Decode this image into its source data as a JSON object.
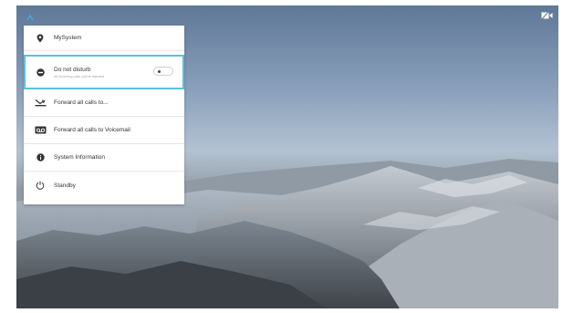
{
  "menu": {
    "system_name": "MySystem",
    "do_not_disturb": {
      "label": "Do not disturb",
      "subtitle": "All incoming calls will be rejected",
      "enabled": false
    },
    "items": [
      {
        "label": "Forward all calls to...",
        "icon": "forward-calls-icon"
      },
      {
        "label": "Forward all calls to Voicemail",
        "icon": "voicemail-icon"
      },
      {
        "label": "System Information",
        "icon": "info-icon"
      },
      {
        "label": "Standby",
        "icon": "power-icon"
      }
    ]
  },
  "colors": {
    "accent": "#5bc0de",
    "panel_bg": "#ffffff",
    "text": "#333333"
  }
}
